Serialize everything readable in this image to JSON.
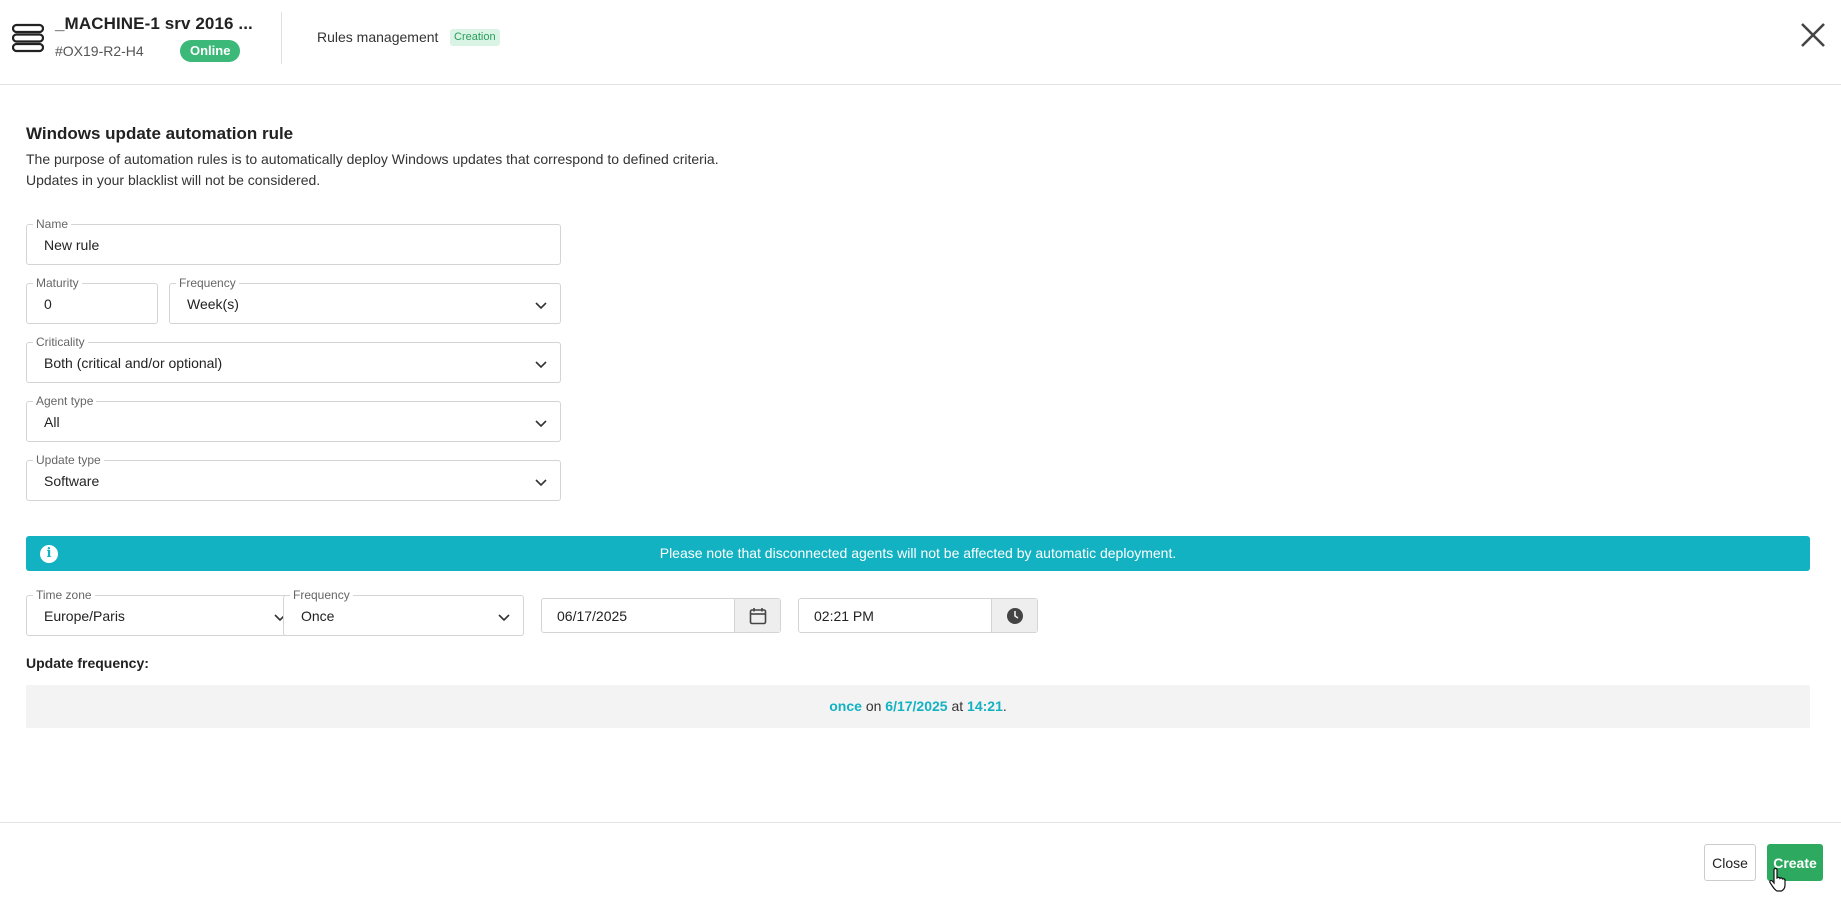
{
  "header": {
    "machine_title": "_MACHINE-1 srv 2016 ...",
    "machine_id": "#OX19-R2-H4",
    "status_badge": "Online",
    "breadcrumb": "Rules management",
    "mode_badge": "Creation",
    "icons": {
      "server": "server-icon",
      "close": "close-icon"
    }
  },
  "main": {
    "title": "Windows update automation rule",
    "description_line1": "The purpose of automation rules is to automatically deploy Windows updates that correspond to defined criteria.",
    "description_line2": "Updates in your blacklist will not be considered."
  },
  "form": {
    "name": {
      "label": "Name",
      "value": "New rule"
    },
    "maturity": {
      "label": "Maturity",
      "value": "0"
    },
    "frequency": {
      "label": "Frequency",
      "value": "Week(s)"
    },
    "criticality": {
      "label": "Criticality",
      "value": "Both (critical and/or optional)"
    },
    "agent_type": {
      "label": "Agent type",
      "value": "All"
    },
    "update_type": {
      "label": "Update type",
      "value": "Software"
    }
  },
  "banner": {
    "text": "Please note that disconnected agents will not be affected by automatic deployment.",
    "icon": "info-icon",
    "color": "#12b2c2"
  },
  "schedule": {
    "time_zone": {
      "label": "Time zone",
      "value": "Europe/Paris"
    },
    "frequency": {
      "label": "Frequency",
      "value": "Once"
    },
    "date": "06/17/2025",
    "time": "02:21 PM",
    "icons": {
      "date": "calendar-icon",
      "time": "clock-icon"
    }
  },
  "summary": {
    "heading": "Update frequency:",
    "freq_word": "once",
    "on_word": "on",
    "date": "6/17/2025",
    "at_word": "at",
    "time": "14:21",
    "period": "."
  },
  "footer": {
    "close_label": "Close",
    "create_label": "Create",
    "create_color": "#2eaa60"
  },
  "colors": {
    "accent": "#12b2c2",
    "online": "#3cb878",
    "creation_bg": "#d9f3e4"
  }
}
